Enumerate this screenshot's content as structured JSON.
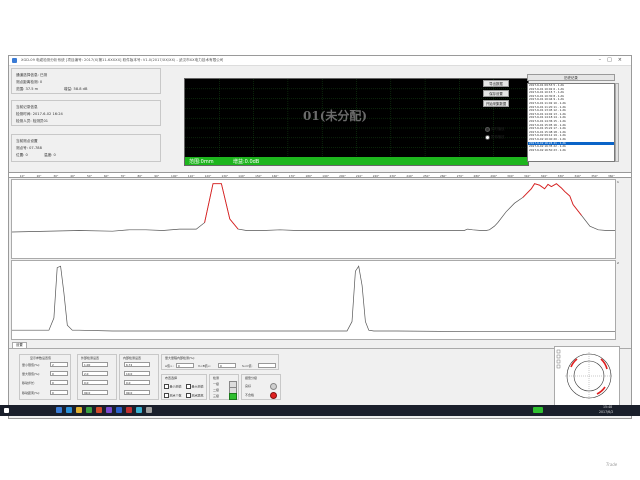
{
  "window": {
    "title": "XGD-09 电缆检测分析系统 [项目编号: 2017(X)第11-6XXXX] 软件版本号: V1.0(2017/XX/XX) - 武汉市XX电力技术有限公司"
  },
  "info_panel": {
    "group1": {
      "line1": "通道选择信息: 已测",
      "line2": "测点距离检测: 0",
      "line3a": "范围: 37.5 m",
      "line3b": "增益: 58.8 dB"
    },
    "group2": {
      "line1": "当前记录信息",
      "line2": "检测时间: 2017-6-02 16:24",
      "line3": "检测人员: 检测员01"
    },
    "group3": {
      "line1": "当前测点设置",
      "line2": "测点号: 07-788",
      "line3a": "位置: 0",
      "line3b": "温度: 0"
    }
  },
  "scope": {
    "center_label": "01(未分配)",
    "range_label": "范围:0mm",
    "gain_label": "增益:0.0dB"
  },
  "buttons": {
    "b1": "导出数据",
    "b2": "保存设置",
    "b3": "开始采集数据"
  },
  "radios": {
    "r1": "实时播放",
    "r2": "暂停播放"
  },
  "history": {
    "title": "历史记录",
    "items": [
      "2017-6-01 09:53 5 - 1.db",
      "2017-6-01 10:02 6 - 1.db",
      "2017-6-01 10:15 7 - 1.db",
      "2017-6-01 10:30 8 - 1.db",
      "2017-6-01 10:44 9 - 1.db",
      "2017-6-01 11:02 10 - 1.db",
      "2017-6-01 11:20 11 - 1.db",
      "2017-6-01 13:45 12 - 1.db",
      "2017-6-01 14:02 13 - 1.db",
      "2017-6-01 14:18 14 - 1.db",
      "2017-6-01 14:36 15 - 1.db",
      "2017-6-01 15:05 16 - 1.db",
      "2017-6-01 15:22 17 - 1.db",
      "2017-6-01 15:48 18 - 1.db",
      "2017-6-02 09:12 19 - 1.db",
      "2017-6-02 10:40 20 - 1.db",
      "2017-6-02 16:24 21 - 1.db",
      "2017-6-02 16:35 22 - 1.db",
      "2017-6-02 16:50 23 - 1.db"
    ],
    "selected_index": 16
  },
  "ruler": {
    "labels": [
      "10°",
      "20°",
      "30°",
      "40°",
      "50°",
      "60°",
      "70°",
      "80°",
      "90°",
      "100°",
      "110°",
      "120°",
      "130°",
      "140°",
      "150°",
      "160°",
      "170°",
      "180°",
      "190°",
      "200°",
      "210°",
      "220°",
      "230°",
      "240°",
      "250°",
      "260°",
      "270°",
      "280°",
      "290°",
      "300°",
      "310°",
      "320°",
      "330°",
      "340°",
      "350°",
      "360°"
    ]
  },
  "plots": {
    "top_corner": "1",
    "bottom_corner": "2"
  },
  "chart_data": [
    {
      "type": "line",
      "x": [
        0,
        40,
        60,
        70,
        80,
        90,
        100,
        110,
        115,
        120,
        125,
        130,
        135,
        140,
        150,
        160,
        170,
        200,
        240,
        270,
        272,
        275,
        280,
        283,
        285,
        288,
        290,
        295,
        300,
        305,
        310,
        312,
        315,
        318,
        320,
        322,
        325,
        328,
        330,
        333,
        335,
        340,
        345,
        350,
        355,
        360
      ],
      "series": [
        {
          "name": "",
          "values": [
            0.32,
            0.34,
            0.33,
            0.35,
            0.35,
            0.34,
            0.36,
            0.36,
            0.45,
            0.99,
            0.99,
            0.5,
            0.36,
            0.34,
            0.34,
            0.35,
            0.34,
            0.34,
            0.34,
            0.34,
            0.36,
            0.35,
            0.34,
            0.34,
            0.35,
            0.4,
            0.45,
            0.6,
            0.72,
            0.8,
            0.92,
            0.99,
            0.97,
            0.92,
            0.98,
            0.95,
            0.99,
            0.93,
            0.88,
            0.82,
            0.7,
            0.55,
            0.4,
            0.35,
            0.34,
            0.34
          ]
        }
      ],
      "ylim": [
        0,
        1
      ],
      "xlim": [
        0,
        360
      ]
    },
    {
      "type": "line",
      "x": [
        0,
        22,
        25,
        27,
        29,
        31,
        33,
        36,
        40,
        60,
        100,
        140,
        180,
        200,
        203,
        205,
        207,
        209,
        211,
        213,
        216,
        230,
        280,
        320,
        360
      ],
      "series": [
        {
          "name": "",
          "values": [
            0.08,
            0.08,
            0.25,
            0.95,
            0.97,
            0.6,
            0.15,
            0.08,
            0.08,
            0.07,
            0.07,
            0.07,
            0.07,
            0.07,
            0.2,
            0.9,
            0.97,
            0.7,
            0.2,
            0.08,
            0.07,
            0.07,
            0.06,
            0.06,
            0.06
          ]
        }
      ],
      "ylim": [
        0,
        1
      ],
      "xlim": [
        0,
        360
      ]
    }
  ],
  "bottom": {
    "tab_label": "设置",
    "g1": {
      "title": "显示参数设置值",
      "rows": [
        {
          "label": "量小限值(%): ",
          "value": "2"
        },
        {
          "label": "量大限值(%): ",
          "value": "0"
        },
        {
          "label": "移动步长: ",
          "value": "0"
        },
        {
          "label": "移动距离(%): ",
          "value": "0"
        }
      ]
    },
    "g2": {
      "title": "外部检测设置",
      "rows": [
        "1.00",
        "2.0",
        "0.0",
        "99.0"
      ]
    },
    "g3": {
      "title": "内部检测设置",
      "rows": [
        "6.72",
        "10.0",
        "0.0",
        "99.0"
      ]
    },
    "g4": {
      "title": "量大量程内部检测(%):",
      "a_label": "A值>:",
      "a_val": "0",
      "b_label": "V<B值<:",
      "b_val": "0",
      "c_label": "S<C值:"
    },
    "g5": {
      "title": "布置选择",
      "c1": "量小测值",
      "c2": "量大测值",
      "c3": "测点个数",
      "c4": "测点距离"
    },
    "g6": {
      "title": "检测",
      "l1": "一级",
      "l2": "二级",
      "l3": "三级"
    },
    "g7": {
      "title": "报警分级",
      "l1": "良好",
      "l2": "不合格"
    }
  },
  "taskbar": {
    "time": "15:48",
    "date": "2017/6/2"
  },
  "watermark": "Trade"
}
